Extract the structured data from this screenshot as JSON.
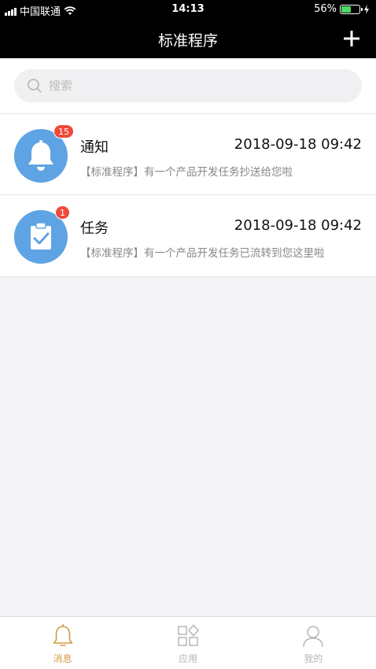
{
  "status_bar": {
    "carrier": "中国联通",
    "time": "14:13",
    "battery": "56%",
    "battery_level": 0.56
  },
  "nav": {
    "title": "标准程序",
    "add_icon": "plus-icon"
  },
  "search": {
    "placeholder": "搜索",
    "value": ""
  },
  "messages": [
    {
      "title": "通知",
      "time": "2018-09-18 09:42",
      "preview": "【标准程序】有一个产品开发任务抄送给您啦",
      "badge": "15",
      "icon": "bell-icon",
      "icon_bg": "#5ea3e4"
    },
    {
      "title": "任务",
      "time": "2018-09-18 09:42",
      "preview": "【标准程序】有一个产品开发任务已流转到您这里啦",
      "badge": "1",
      "icon": "clipboard-check-icon",
      "icon_bg": "#5ea3e4"
    }
  ],
  "tabs": [
    {
      "label": "消息",
      "icon": "bell-icon",
      "active": true
    },
    {
      "label": "应用",
      "icon": "grid-icon",
      "active": false
    },
    {
      "label": "我的",
      "icon": "user-icon",
      "active": false
    }
  ],
  "colors": {
    "accent": "#d49a43",
    "badge": "#ef4a3c",
    "header": "#000000",
    "avatar": "#5ea3e4"
  }
}
